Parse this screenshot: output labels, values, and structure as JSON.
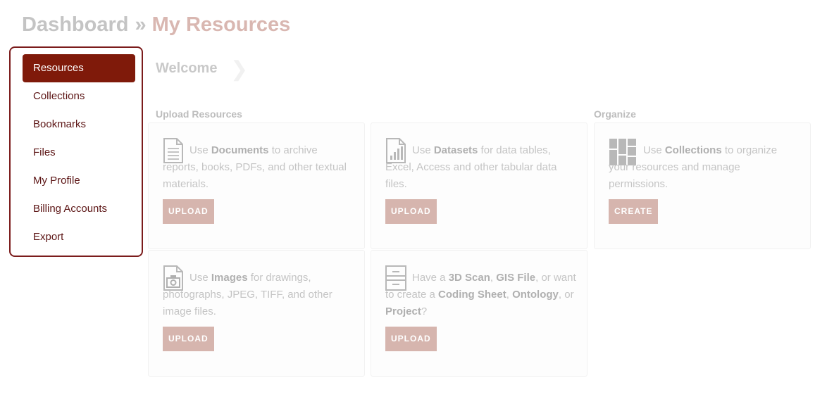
{
  "breadcrumb": {
    "parent": "Dashboard",
    "separator": "»",
    "current": "My Resources"
  },
  "sidebar": {
    "items": [
      {
        "label": "Resources",
        "active": true
      },
      {
        "label": "Collections"
      },
      {
        "label": "Bookmarks"
      },
      {
        "label": "Files"
      },
      {
        "label": "My Profile"
      },
      {
        "label": "Billing Accounts"
      },
      {
        "label": "Export"
      }
    ]
  },
  "main": {
    "welcome": "Welcome",
    "sections": {
      "upload": "Upload Resources",
      "organize": "Organize"
    },
    "cards": {
      "documents": {
        "icon": "document-icon",
        "pre": "Use ",
        "bold": "Documents",
        "post": " to archive reports, books, PDFs, and other textual materials.",
        "button": "UPLOAD"
      },
      "datasets": {
        "icon": "dataset-chart-icon",
        "pre": "Use ",
        "bold": "Datasets",
        "post": " for data tables, Excel, Access and other tabular data files.",
        "button": "UPLOAD"
      },
      "collections": {
        "icon": "collections-grid-icon",
        "pre": "Use ",
        "bold": "Collections",
        "post": " to organize your resources and manage permissions.",
        "button": "CREATE"
      },
      "images": {
        "icon": "image-camera-icon",
        "pre": "Use ",
        "bold": "Images",
        "post": " for drawings, photographs, JPEG, TIFF, and other image files.",
        "button": "UPLOAD"
      },
      "other": {
        "icon": "other-resource-icon",
        "t1": "Have a ",
        "b1": "3D Scan",
        "t2": ", ",
        "b2": "GIS File",
        "t3": ", or want to create a ",
        "b3": "Coding Sheet",
        "t4": ", ",
        "b4": "Ontology",
        "t5": ", or ",
        "b5": "Project",
        "t6": "?",
        "button": "UPLOAD"
      }
    }
  },
  "colors": {
    "accent": "#7f1a0a",
    "button": "#d6b5ae",
    "border": "#7b1c1c"
  }
}
